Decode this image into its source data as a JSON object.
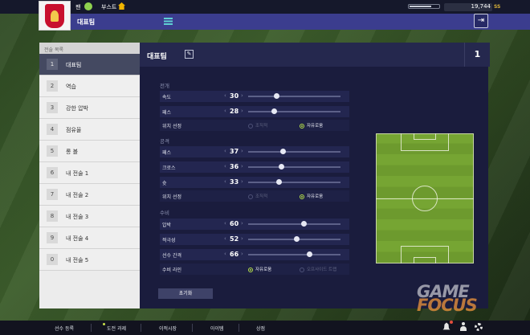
{
  "topbar": {
    "user_name": "팬",
    "boost_label": "부스트",
    "energy_level": 0.75,
    "coins": "19,744",
    "coin_unit": "SS"
  },
  "subbar": {
    "title": "대표팀"
  },
  "tactic_list": {
    "header": "전술 목록",
    "items": [
      {
        "num": "1",
        "label": "대표팀",
        "selected": true
      },
      {
        "num": "2",
        "label": "역습",
        "selected": false
      },
      {
        "num": "3",
        "label": "강한 압박",
        "selected": false
      },
      {
        "num": "4",
        "label": "점유율",
        "selected": false
      },
      {
        "num": "5",
        "label": "롱 볼",
        "selected": false
      },
      {
        "num": "6",
        "label": "내 전술 1",
        "selected": false
      },
      {
        "num": "7",
        "label": "내 전술 2",
        "selected": false
      },
      {
        "num": "8",
        "label": "내 전술 3",
        "selected": false
      },
      {
        "num": "9",
        "label": "내 전술 4",
        "selected": false
      },
      {
        "num": "0",
        "label": "내 전술 5",
        "selected": false
      }
    ]
  },
  "main": {
    "title": "대표팀",
    "tactic_number": "1",
    "buildup": {
      "section": "전개",
      "speed": {
        "label": "속도",
        "value": "30",
        "level": 0.3
      },
      "pass": {
        "label": "패스",
        "value": "28",
        "level": 0.28
      },
      "positioning": {
        "label": "위치 선정",
        "opt1": "조직적",
        "opt2": "자유로움"
      }
    },
    "attack": {
      "section": "공격",
      "pass": {
        "label": "패스",
        "value": "37",
        "level": 0.37
      },
      "cross": {
        "label": "크로스",
        "value": "36",
        "level": 0.36
      },
      "shoot": {
        "label": "슛",
        "value": "33",
        "level": 0.33
      },
      "positioning": {
        "label": "위치 선정",
        "opt1": "조직적",
        "opt2": "자유로움"
      }
    },
    "defence": {
      "section": "수비",
      "pressure": {
        "label": "압박",
        "value": "60",
        "level": 0.6
      },
      "aggression": {
        "label": "적극성",
        "value": "52",
        "level": 0.52
      },
      "width": {
        "label": "선수 간격",
        "value": "66",
        "level": 0.66
      },
      "line": {
        "label": "수비 라인",
        "opt1": "자유로움",
        "opt2": "오프사이드 트랩"
      }
    },
    "reset_label": "초기화"
  },
  "watermark": {
    "line1": "GAME",
    "line2": "FOCUS"
  },
  "bottom_nav": {
    "items": [
      "선수 등록",
      "도전 과제",
      "이적시장",
      "아이템",
      "상점"
    ]
  }
}
